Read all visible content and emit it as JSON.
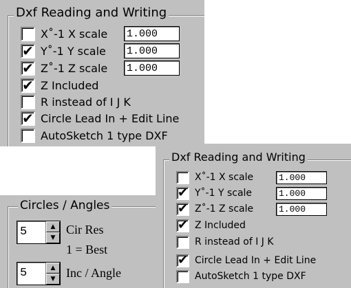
{
  "dxf_panel_large": {
    "title": "Dxf   Reading and Writing",
    "rows": [
      {
        "label": "X˚-1  X scale",
        "checked": false,
        "scale": "1.000"
      },
      {
        "label": "Y˚-1  Y scale",
        "checked": true,
        "scale": "1.000"
      },
      {
        "label": "Z˚-1  Z scale",
        "checked": true,
        "scale": "1.000"
      },
      {
        "label": "Z Included",
        "checked": true
      },
      {
        "label": "R instead of I J K",
        "checked": false
      },
      {
        "label": "Circle Lead In + Edit Line",
        "checked": true
      },
      {
        "label": "AutoSketch 1 type DXF",
        "checked": false
      }
    ]
  },
  "dxf_panel_small": {
    "title": "Dxf   Reading and Writing",
    "rows": [
      {
        "label": "X˚-1  X scale",
        "checked": false,
        "scale": "1.000"
      },
      {
        "label": "Y˚-1  Y scale",
        "checked": true,
        "scale": "1.000"
      },
      {
        "label": "Z˚-1  Z scale",
        "checked": true,
        "scale": "1.000"
      },
      {
        "label": "Z Included",
        "checked": true
      },
      {
        "label": "R instead of I J K",
        "checked": false
      },
      {
        "label": "Circle Lead In + Edit Line",
        "checked": true
      },
      {
        "label": "AutoSketch 1 type DXF",
        "checked": false
      }
    ]
  },
  "circles_panel": {
    "title": "Circles / Angles",
    "cir_res": {
      "value": "5",
      "label": "Cir Res"
    },
    "note": "1 = Best",
    "inc_angle": {
      "value": "5",
      "label": "Inc / Angle"
    }
  },
  "colors": {
    "face": "#c0c0c0",
    "background": "#ffffff"
  }
}
